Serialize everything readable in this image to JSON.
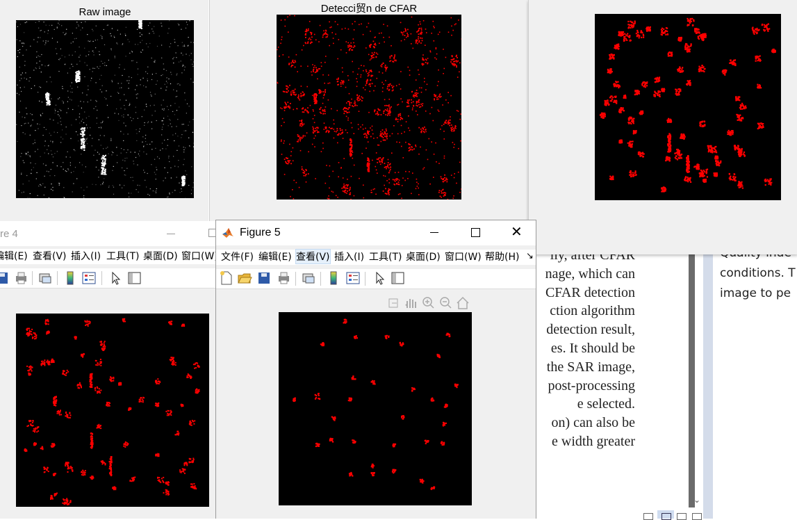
{
  "figure_raw": {
    "axis_title": "Raw image"
  },
  "figure_cfar": {
    "axis_title": "Detecci贸n de CFAR"
  },
  "figure4": {
    "window_title": "re 4",
    "menus": [
      "编辑(E)",
      "查看(V)",
      "插入(I)",
      "工具(T)",
      "桌面(D)",
      "窗口(W)"
    ]
  },
  "figure5": {
    "window_title": "Figure 5",
    "menus": [
      "文件(F)",
      "编辑(E)",
      "查看(V)",
      "插入(I)",
      "工具(T)",
      "桌面(D)",
      "窗口(W)",
      "帮助(H)"
    ],
    "toolbar_icons": [
      "new-figure-icon",
      "open-icon",
      "save-icon",
      "print-icon",
      "link-icon",
      "colorbar-icon",
      "legend-icon",
      "pointer-icon",
      "property-inspector-icon"
    ],
    "axes_toolbar_icons": [
      "export-icon",
      "pan-icon",
      "zoom-in-icon",
      "zoom-out-icon",
      "home-icon"
    ]
  },
  "document": {
    "serif_lines": [
      "lly, after CFAR",
      "nage, which can",
      "CFAR detection",
      "ction algorithm",
      "detection result,",
      "es. It should be",
      "the SAR image,",
      "post-processing",
      "e selected.",
      "on) can also be",
      "e width greater"
    ],
    "sans_lines": [
      "Quality inde",
      "conditions. T",
      "image to pe"
    ]
  },
  "colors": {
    "detection_red": "#ff0000",
    "figure_bg": "#f0f0f0",
    "axes_bg": "#000000"
  }
}
